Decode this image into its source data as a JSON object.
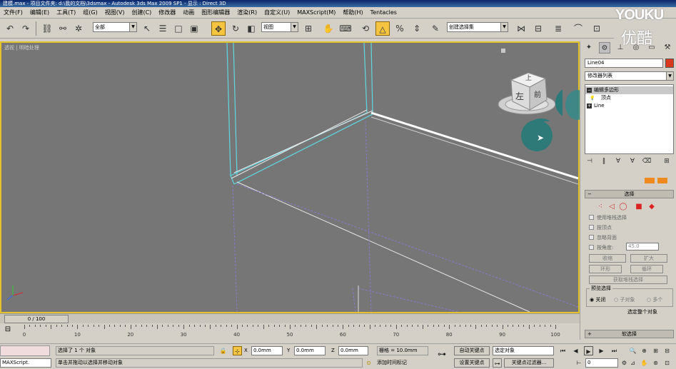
{
  "window": {
    "title": "建模.max    - 项目文件夹: d:\\我的文档\\3dsmax    - Autodesk 3ds Max  2009 SP1    - 显示 : Direct 3D"
  },
  "menu": [
    "文件(F)",
    "编辑(E)",
    "工具(T)",
    "组(G)",
    "视图(V)",
    "创建(C)",
    "修改器",
    "动画",
    "图形编辑器",
    "渲染(R)",
    "自定义(U)",
    "MAXScript(M)",
    "帮助(H)",
    "Tentacles"
  ],
  "toolbar": {
    "selection_filter": "全部",
    "ref_coord": "视图",
    "named_selection": "创建选择集"
  },
  "viewport": {
    "label": "透视 | 明暗处理"
  },
  "viewcube": {
    "face_top": "上",
    "face_left": "左",
    "face_front": "前"
  },
  "command_panel": {
    "object_name": "Line04",
    "object_color": "#d93a1e",
    "modifier_list": "修改器列表",
    "stack": [
      {
        "label": "编辑多边形",
        "selected": true
      },
      {
        "label": "顶点",
        "selected": false
      },
      {
        "label": "Line",
        "selected": false
      }
    ],
    "rollout_select": "选择",
    "checks": [
      "使用堆栈选择",
      "按顶点",
      "忽略背面",
      "按角度:"
    ],
    "angle_value": "45.0",
    "btn_shrink": "收缩",
    "btn_grow": "扩大",
    "btn_ring": "环形",
    "btn_loop": "循环",
    "btn_get_stack": "获取堆栈选择",
    "preview_group": "预览选择",
    "preview_off": "关闭",
    "preview_subobj": "子对象",
    "preview_multi": "多个",
    "whole_object": "选定整个对象",
    "rollout_soft": "软选择"
  },
  "timeline": {
    "frame_display": "0 / 100",
    "ticks": [
      0,
      10,
      20,
      30,
      40,
      50,
      60,
      70,
      80,
      90,
      100
    ]
  },
  "status": {
    "maxscript_label": "MAXScript.",
    "selected_text": "选择了 1 个 对象",
    "prompt_text": "单击并拖动以选择并移动对象",
    "x": "0.0mm",
    "y": "0.0mm",
    "z": "0.0mm",
    "grid": "栅格 = 10.0mm",
    "add_time_tag": "添加时间标记",
    "auto_key": "自动关键点",
    "set_key": "设置关键点",
    "selected_object": "选定对象",
    "key_filters": "关键点过滤器...",
    "current_frame": "0"
  },
  "watermark": {
    "en": "YOUKU",
    "cn": "优酷"
  }
}
